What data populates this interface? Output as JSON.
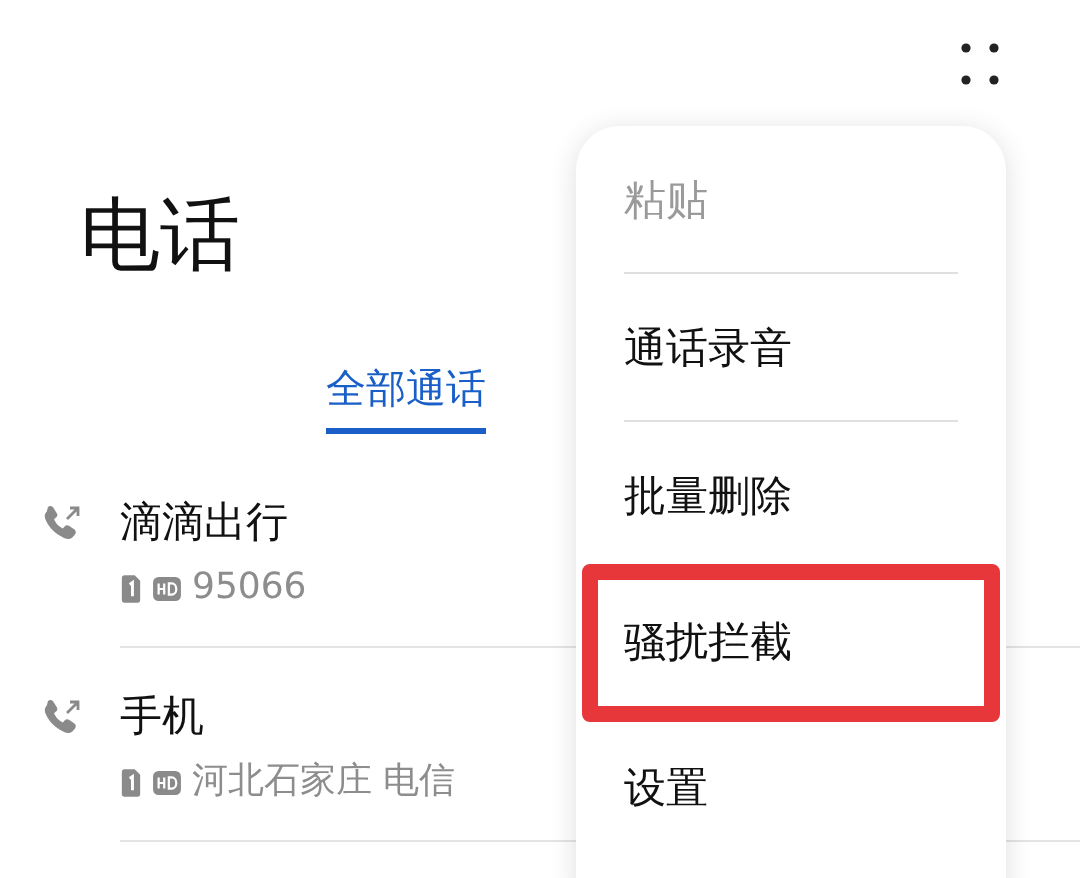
{
  "title": "电话",
  "tabs": [
    {
      "label": "全部通话",
      "selected": true
    }
  ],
  "calls": [
    {
      "name": "滴滴出行",
      "detail": "95066"
    },
    {
      "name": "手机",
      "detail": "河北石家庄 电信"
    }
  ],
  "menu": {
    "items": [
      {
        "label": "粘贴",
        "disabled": true,
        "highlighted": false
      },
      {
        "label": "通话录音",
        "disabled": false,
        "highlighted": false
      },
      {
        "label": "批量删除",
        "disabled": false,
        "highlighted": false
      },
      {
        "label": "骚扰拦截",
        "disabled": false,
        "highlighted": true
      },
      {
        "label": "设置",
        "disabled": false,
        "highlighted": false
      }
    ]
  }
}
